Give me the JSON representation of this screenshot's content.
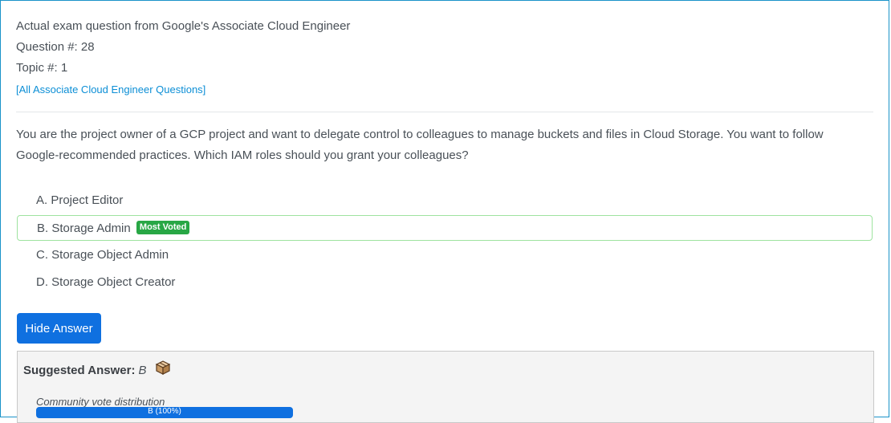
{
  "header": {
    "exam_line": "Actual exam question from Google's Associate Cloud Engineer",
    "question_number": "Question #: 28",
    "topic": "Topic #: 1",
    "all_questions_link": "[All Associate Cloud Engineer Questions]"
  },
  "question": {
    "text": "You are the project owner of a GCP project and want to delegate control to colleagues to manage buckets and files in Cloud Storage. You want to follow Google-recommended practices. Which IAM roles should you grant your colleagues?"
  },
  "choices": [
    {
      "label": "A. Project Editor"
    },
    {
      "label": "B. Storage Admin",
      "badge": "Most Voted"
    },
    {
      "label": "C. Storage Object Admin"
    },
    {
      "label": "D. Storage Object Creator"
    }
  ],
  "buttons": {
    "hide_answer": "Hide Answer"
  },
  "answer": {
    "suggested_label": "Suggested Answer:",
    "suggested_value": "B",
    "icon": "box-icon",
    "vote_caption": "Community vote distribution",
    "vote_bar_label": "B (100%)",
    "vote_percent": 100
  },
  "colors": {
    "accent": "#0f70e0",
    "badge": "#28a745",
    "link": "#0d8fd6",
    "frame_border": "#1a93c9"
  }
}
